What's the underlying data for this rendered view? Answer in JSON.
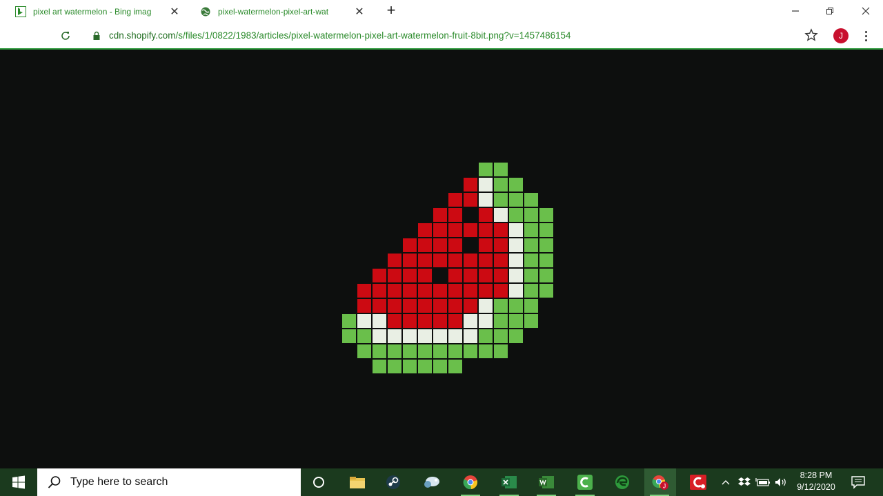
{
  "tabs": [
    {
      "title": "pixel art watermelon - Bing imag",
      "icon": "bing-icon",
      "active": false
    },
    {
      "title": "pixel-watermelon-pixel-art-wat",
      "icon": "globe-icon",
      "active": true
    }
  ],
  "address": {
    "host": "cdn.shopify.com",
    "path": "/s/files/1/0822/1983/articles/pixel-watermelon-pixel-art-watermelon-fruit-8bit.png?v=1457486154"
  },
  "profile": {
    "initial": "J"
  },
  "image": {
    "subject": "pixel-art watermelon slice",
    "palette": {
      "G": "#6abf4b",
      "W": "#e9efe4",
      "R": "#cc0a12",
      "K": "#0d0f0e"
    },
    "grid": [
      ".........GG....",
      "........RWGG...",
      ".......RRWGGG..",
      "......RRKRWGGG.",
      ".....RRRRRRWGG.",
      "....RRRRKRRWGG.",
      "...RRRRRRRRWGG.",
      "..RRRRKRRRRWGG.",
      ".RRRRRRRRRRWGG.",
      ".RRRRRRRRWGGG..",
      "GWWRRRRRWWGGG..",
      "GGWWWWWWWGGG...",
      ".GGGGGGGGGG....",
      "..GGGGGG......."
    ]
  },
  "taskbar": {
    "search_placeholder": "Type here to search",
    "apps": [
      "cortana-icon",
      "file-explorer-icon",
      "steam-icon",
      "network-app-icon",
      "chrome-icon",
      "excel-icon",
      "word-icon",
      "camtasia-icon",
      "edge-icon",
      "chrome-profile-icon",
      "camtasia-recorder-icon"
    ],
    "time": "8:28 PM",
    "date": "9/12/2020"
  },
  "colors": {
    "accent": "#2e9a3c",
    "taskbar": "#1b3a1e",
    "background": "#0d0f0e"
  }
}
